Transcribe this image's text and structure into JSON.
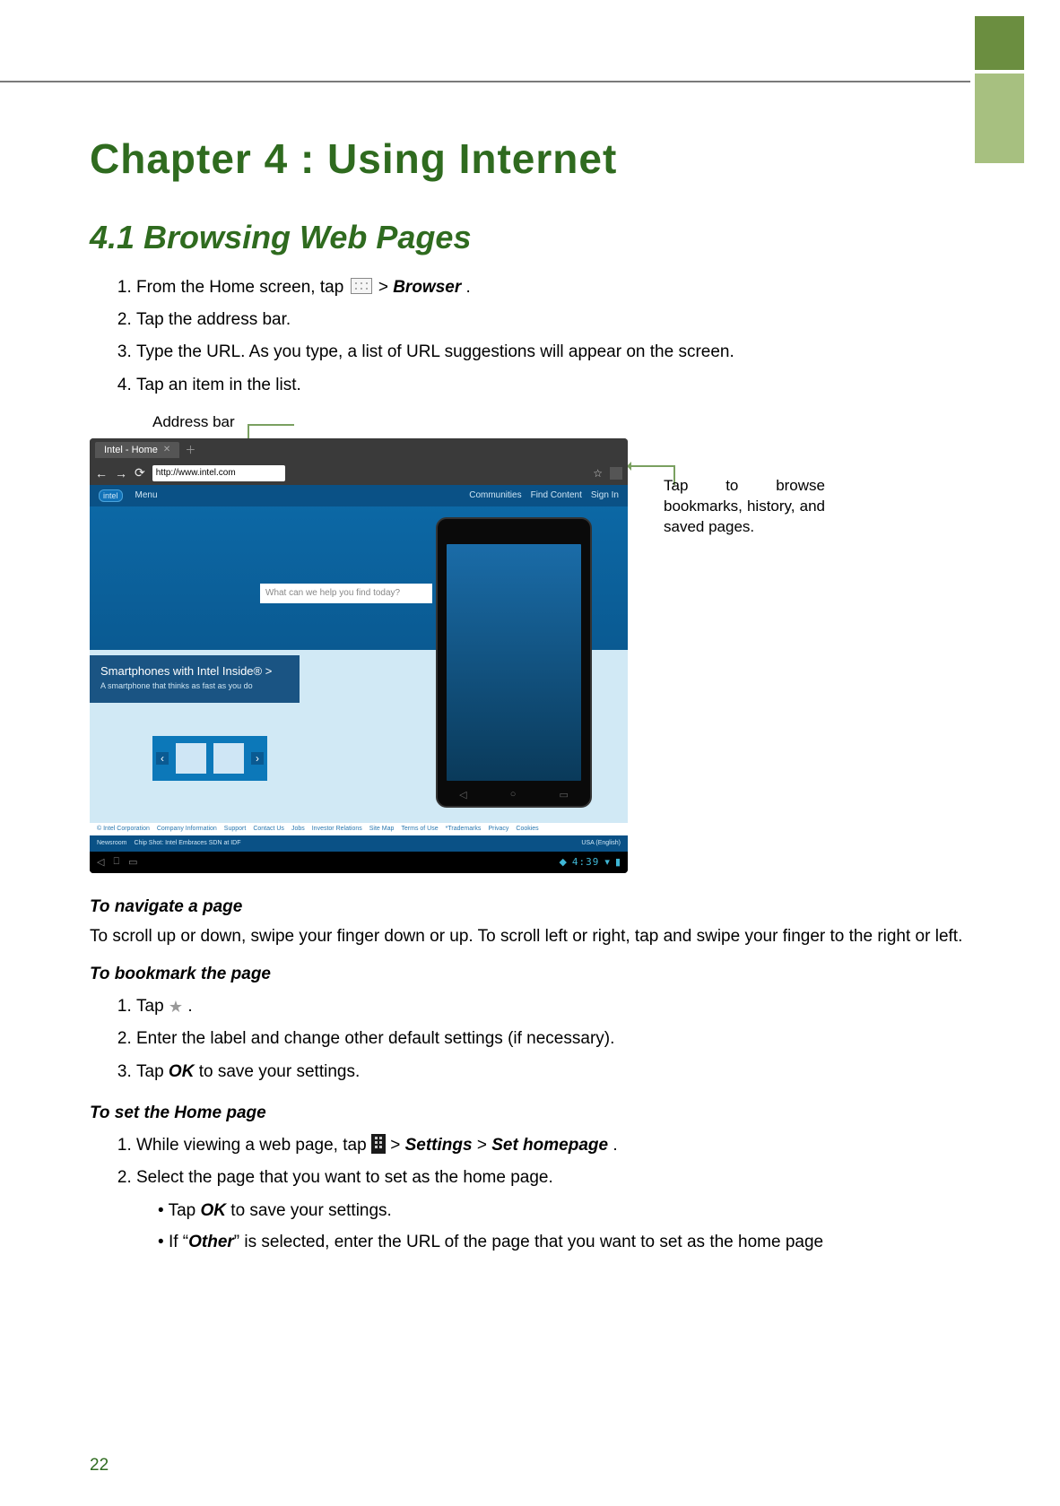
{
  "chapter_title": "Chapter  4 : Using Internet",
  "section_title": "4.1 Browsing Web Pages",
  "steps_main": {
    "s1_a": "From the Home screen, tap  ",
    "s1_b": "  > ",
    "s1_c": "Browser",
    "s1_d": ".",
    "s2": "Tap the address bar.",
    "s3": "Type the URL. As you type, a list of URL suggestions will appear on the screen.",
    "s4": "Tap an item in the list."
  },
  "figure": {
    "address_bar_label": "Address bar",
    "right_callout": "Tap to browse bookmarks, history, and saved pages.",
    "tab_title": "Intel - Home",
    "url_value": "http://www.intel.com",
    "intel_logo": "intel",
    "menu_label": "Menu",
    "top_links": {
      "a": "Communities",
      "b": "Find Content",
      "c": "Sign In"
    },
    "search_placeholder": "What can we help you find today?",
    "promo_title": "Smartphones with Intel Inside® >",
    "promo_sub": "A smartphone that thinks as fast as you do",
    "footer1": {
      "a": "© Intel Corporation",
      "b": "Company Information",
      "c": "Support",
      "d": "Contact Us",
      "e": "Jobs",
      "f": "Investor Relations",
      "g": "Site Map",
      "h": "Terms of Use",
      "i": "*Trademarks",
      "j": "Privacy",
      "k": "Cookies"
    },
    "footer2": {
      "a": "Newsroom",
      "b": "Chip Shot: Intel Embraces SDN at IDF",
      "c": "USA (English)"
    },
    "clock": "4:39"
  },
  "navigate": {
    "heading": "To navigate a page",
    "body": "To scroll up or down, swipe your finger down or up. To scroll left or right, tap and swipe your finger to the right or left."
  },
  "bookmark": {
    "heading": "To bookmark the page",
    "s1_a": "Tap  ",
    "s1_b": ".",
    "s2": "Enter the label and change other default settings (if necessary).",
    "s3_a": "Tap ",
    "s3_b": "OK",
    "s3_c": " to save your settings."
  },
  "homepage": {
    "heading": "To set the Home page",
    "s1_a": "While viewing a web page, tap  ",
    "s1_b": "  > ",
    "s1_c": "Settings",
    "s1_d": " > ",
    "s1_e": "Set homepage",
    "s1_f": ".",
    "s2": "Select the page that you want to set as the home page.",
    "b1_a": "Tap ",
    "b1_b": "OK",
    "b1_c": " to save your settings.",
    "b2_a": "If “",
    "b2_b": "Other",
    "b2_c": "” is selected, enter the URL of the page that you want to set as the home page"
  },
  "page_number": "22"
}
